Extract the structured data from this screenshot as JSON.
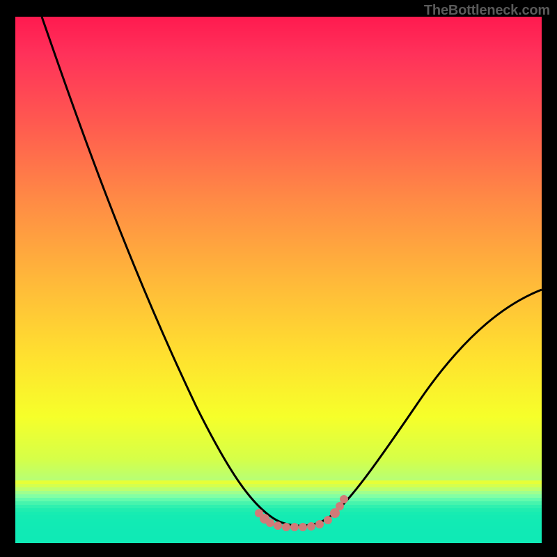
{
  "watermark": "TheBottleneck.com",
  "chart_data": {
    "type": "line",
    "title": "",
    "xlabel": "",
    "ylabel": "",
    "xlim": [
      0,
      100
    ],
    "ylim": [
      0,
      100
    ],
    "grid": false,
    "series": [
      {
        "name": "bottleneck-curve",
        "x": [
          5,
          12,
          20,
          30,
          38,
          44,
          48,
          50,
          54,
          58,
          60,
          62,
          70,
          80,
          92,
          100
        ],
        "values": [
          100,
          80,
          62,
          42,
          27,
          15,
          7,
          4,
          3,
          3,
          4,
          6,
          15,
          27,
          40,
          48
        ]
      }
    ],
    "annotations": [
      {
        "name": "valley-dots",
        "x_start": 47,
        "x_end": 62,
        "y": 4
      }
    ],
    "colors": {
      "curve": "#000000",
      "dots": "#d17a78",
      "background_top": "#ff1a4f",
      "background_bottom": "#14edb4"
    }
  }
}
